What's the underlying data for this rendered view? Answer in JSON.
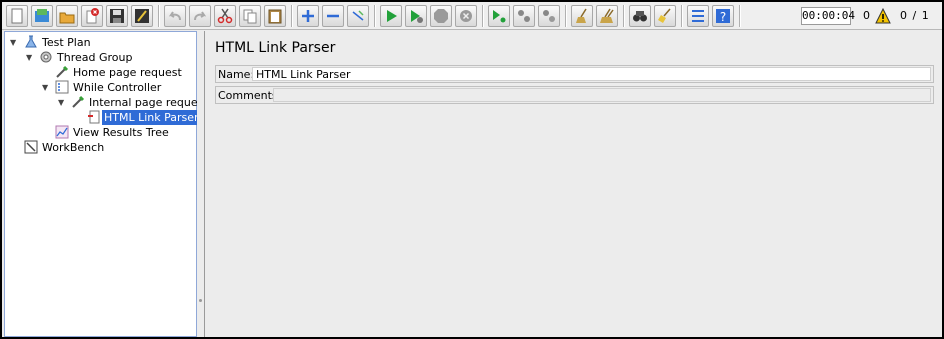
{
  "toolbar": {
    "buttons": [
      {
        "name": "new-icon"
      },
      {
        "name": "templates-icon"
      },
      {
        "name": "open-icon"
      },
      {
        "name": "close-icon"
      },
      {
        "name": "save-icon"
      },
      {
        "name": "save-as-icon"
      },
      {
        "name": "undo-icon"
      },
      {
        "name": "redo-icon"
      },
      {
        "name": "cut-icon"
      },
      {
        "name": "copy-icon"
      },
      {
        "name": "paste-icon"
      },
      {
        "name": "expand-all-icon"
      },
      {
        "name": "collapse-all-icon"
      },
      {
        "name": "toggle-icon"
      },
      {
        "name": "start-icon"
      },
      {
        "name": "start-no-pauses-icon"
      },
      {
        "name": "stop-icon"
      },
      {
        "name": "shutdown-icon"
      },
      {
        "name": "remote-start-icon"
      },
      {
        "name": "remote-stop-icon"
      },
      {
        "name": "remote-shutdown-icon"
      },
      {
        "name": "clear-icon"
      },
      {
        "name": "clear-all-icon"
      },
      {
        "name": "search-icon"
      },
      {
        "name": "reset-search-icon"
      },
      {
        "name": "function-helper-icon"
      },
      {
        "name": "help-icon"
      }
    ],
    "timer": "00:00:04",
    "error_count": "0",
    "threads": "0 / 1"
  },
  "tree": {
    "items": [
      {
        "label": "Test Plan",
        "icon": "test-plan-icon",
        "level": 0,
        "expanded": true
      },
      {
        "label": "Thread Group",
        "icon": "thread-group-icon",
        "level": 1,
        "expanded": true
      },
      {
        "label": "Home page request",
        "icon": "sampler-icon",
        "level": 2
      },
      {
        "label": "While Controller",
        "icon": "controller-icon",
        "level": 2,
        "expanded": true
      },
      {
        "label": "Internal page request",
        "icon": "sampler-icon",
        "level": 3,
        "expanded": true
      },
      {
        "label": "HTML Link Parser",
        "icon": "preprocessor-icon",
        "level": 4,
        "selected": true
      },
      {
        "label": "View Results Tree",
        "icon": "listener-icon",
        "level": 2
      },
      {
        "label": "WorkBench",
        "icon": "workbench-icon",
        "level": 0
      }
    ]
  },
  "detail": {
    "title": "HTML Link Parser",
    "name_label": "Name:",
    "name_value": "HTML Link Parser",
    "comments_label": "Comments:",
    "comments_value": ""
  }
}
